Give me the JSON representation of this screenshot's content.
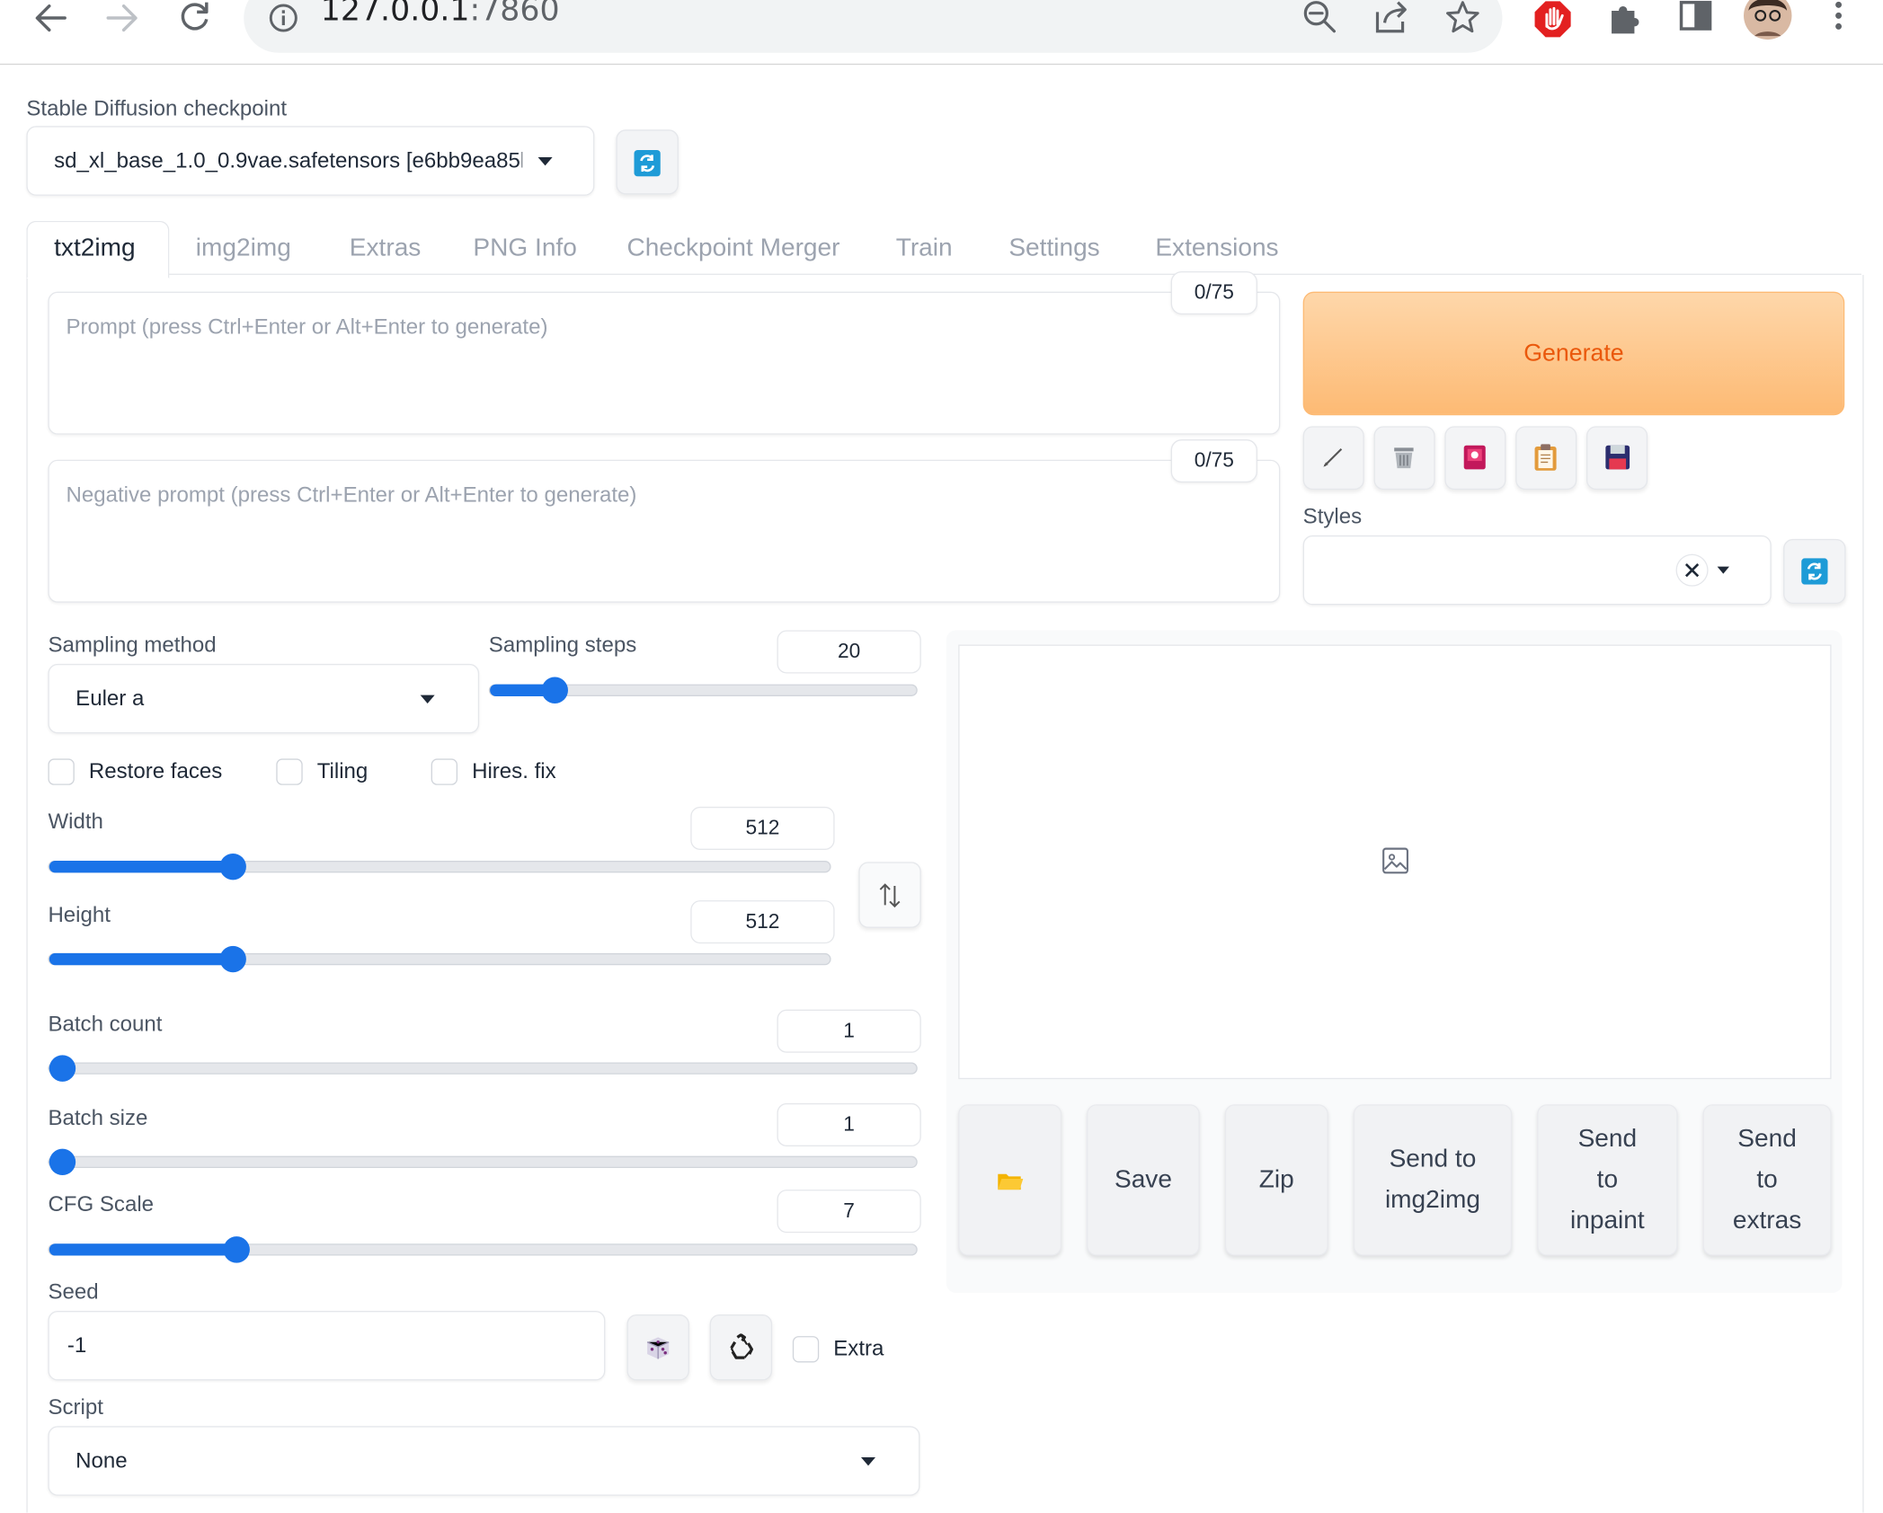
{
  "browser": {
    "url_host": "127.0.0.1",
    "url_port": ":7860",
    "icons": [
      "back-icon",
      "forward-icon",
      "reload-icon",
      "site-info-icon",
      "zoom-icon",
      "share-icon",
      "bookmark-star-icon",
      "adblock-icon",
      "extensions-icon",
      "side-panel-icon",
      "profile-avatar",
      "menu-icon"
    ]
  },
  "checkpoint": {
    "label": "Stable Diffusion checkpoint",
    "value": "sd_xl_base_1.0_0.9vae.safetensors [e6bb9ea85l"
  },
  "tabs": [
    {
      "label": "txt2img",
      "active": true
    },
    {
      "label": "img2img"
    },
    {
      "label": "Extras"
    },
    {
      "label": "PNG Info"
    },
    {
      "label": "Checkpoint Merger"
    },
    {
      "label": "Train"
    },
    {
      "label": "Settings"
    },
    {
      "label": "Extensions"
    }
  ],
  "prompt": {
    "placeholder": "Prompt (press Ctrl+Enter or Alt+Enter to generate)",
    "counter": "0/75"
  },
  "negative_prompt": {
    "placeholder": "Negative prompt (press Ctrl+Enter or Alt+Enter to generate)",
    "counter": "0/75"
  },
  "generate": {
    "label": "Generate"
  },
  "tool_buttons": [
    "pencil-icon",
    "trash-icon",
    "image-red-icon",
    "clipboard-icon",
    "save-disk-icon"
  ],
  "styles": {
    "label": "Styles",
    "value": ""
  },
  "sampling_method": {
    "label": "Sampling method",
    "value": "Euler a"
  },
  "sampling_steps": {
    "label": "Sampling steps",
    "value": "20",
    "min": 1,
    "max": 150,
    "level": 20
  },
  "checkboxes": {
    "restore_faces": "Restore faces",
    "tiling": "Tiling",
    "hires_fix": "Hires. fix"
  },
  "width": {
    "label": "Width",
    "value": "512",
    "min": 64,
    "max": 2048,
    "level": 512
  },
  "height": {
    "label": "Height",
    "value": "512",
    "min": 64,
    "max": 2048,
    "level": 512
  },
  "batch_count": {
    "label": "Batch count",
    "value": "1",
    "min": 1,
    "max": 100,
    "level": 1
  },
  "batch_size": {
    "label": "Batch size",
    "value": "1",
    "min": 1,
    "max": 8,
    "level": 1
  },
  "cfg_scale": {
    "label": "CFG Scale",
    "value": "7",
    "min": 1,
    "max": 30,
    "level": 7
  },
  "seed": {
    "label": "Seed",
    "value": "-1",
    "extra_label": "Extra"
  },
  "script": {
    "label": "Script",
    "value": "None"
  },
  "actions": {
    "save": "Save",
    "zip": "Zip",
    "send_img2img": [
      "Send to",
      "img2img"
    ],
    "send_inpaint": [
      "Send",
      "to",
      "inpaint"
    ],
    "send_extras": [
      "Send",
      "to",
      "extras"
    ]
  },
  "colors": {
    "accent": "#1a73e8",
    "generate_bg": "#fdba74",
    "generate_text": "#ea580c"
  }
}
